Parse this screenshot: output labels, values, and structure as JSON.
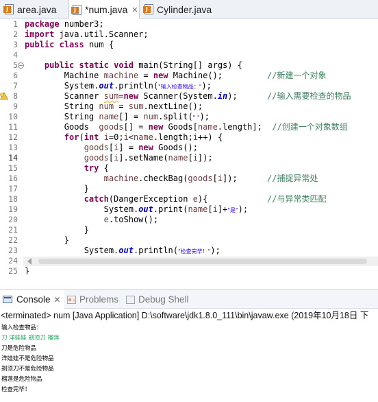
{
  "editor_tabs": [
    {
      "label": "area.java",
      "active": false
    },
    {
      "label": "*num.java",
      "active": true
    },
    {
      "label": "Cylinder.java",
      "active": false
    }
  ],
  "code_lines": [
    {
      "n": "1",
      "tokens": [
        {
          "t": "package",
          "c": "kw"
        },
        {
          "t": " number3;"
        }
      ]
    },
    {
      "n": "2",
      "tokens": [
        {
          "t": "import",
          "c": "kw"
        },
        {
          "t": " java.util.Scanner;"
        }
      ]
    },
    {
      "n": "3",
      "tokens": [
        {
          "t": "public",
          "c": "kw"
        },
        {
          "t": " "
        },
        {
          "t": "class",
          "c": "kw"
        },
        {
          "t": " num {"
        }
      ]
    },
    {
      "n": "4",
      "tokens": []
    },
    {
      "n": "5",
      "fold": true,
      "tokens": [
        {
          "t": "    "
        },
        {
          "t": "public",
          "c": "kw"
        },
        {
          "t": " "
        },
        {
          "t": "static",
          "c": "kw"
        },
        {
          "t": " "
        },
        {
          "t": "void",
          "c": "kw"
        },
        {
          "t": " main(String[] args) {"
        }
      ]
    },
    {
      "n": "6",
      "tokens": [
        {
          "t": "        Machine "
        },
        {
          "t": "machine",
          "c": "var"
        },
        {
          "t": " = "
        },
        {
          "t": "new",
          "c": "kw"
        },
        {
          "t": " Machine();         "
        },
        {
          "t": "//新建一个对象",
          "c": "cmt"
        }
      ]
    },
    {
      "n": "7",
      "tokens": [
        {
          "t": "        System."
        },
        {
          "t": "out",
          "c": "fld"
        },
        {
          "t": ".println("
        },
        {
          "t": "\"输入检查物品：\"",
          "c": "str"
        },
        {
          "t": ");"
        }
      ]
    },
    {
      "n": "8",
      "warn": true,
      "tokens": [
        {
          "t": "        Scanner "
        },
        {
          "t": "sum",
          "c": "var warnline"
        },
        {
          "t": "="
        },
        {
          "t": "new",
          "c": "kw"
        },
        {
          "t": " Scanner(System."
        },
        {
          "t": "in",
          "c": "fld"
        },
        {
          "t": ");      "
        },
        {
          "t": "//输入需要检查的物品",
          "c": "cmt"
        }
      ]
    },
    {
      "n": "9",
      "tokens": [
        {
          "t": "        String "
        },
        {
          "t": "num",
          "c": "var"
        },
        {
          "t": " = "
        },
        {
          "t": "sum",
          "c": "var"
        },
        {
          "t": ".nextLine();"
        }
      ]
    },
    {
      "n": "10",
      "tokens": [
        {
          "t": "        String "
        },
        {
          "t": "name",
          "c": "var"
        },
        {
          "t": "[] = "
        },
        {
          "t": "num",
          "c": "var"
        },
        {
          "t": ".split("
        },
        {
          "t": "\" \"",
          "c": "str"
        },
        {
          "t": ");"
        }
      ]
    },
    {
      "n": "11",
      "tokens": [
        {
          "t": "        Goods  "
        },
        {
          "t": "goods",
          "c": "var"
        },
        {
          "t": "[] = "
        },
        {
          "t": "new",
          "c": "kw"
        },
        {
          "t": " Goods["
        },
        {
          "t": "name",
          "c": "var"
        },
        {
          "t": ".length];  "
        },
        {
          "t": "//创建一个对象数组",
          "c": "cmt"
        }
      ]
    },
    {
      "n": "12",
      "tokens": [
        {
          "t": "        "
        },
        {
          "t": "for",
          "c": "kw"
        },
        {
          "t": "("
        },
        {
          "t": "int",
          "c": "kw"
        },
        {
          "t": " "
        },
        {
          "t": "i",
          "c": "var"
        },
        {
          "t": "=0;"
        },
        {
          "t": "i",
          "c": "var"
        },
        {
          "t": "<"
        },
        {
          "t": "name",
          "c": "var"
        },
        {
          "t": ".length;"
        },
        {
          "t": "i",
          "c": "var"
        },
        {
          "t": "++) {"
        }
      ]
    },
    {
      "n": "13",
      "tokens": [
        {
          "t": "            "
        },
        {
          "t": "goods",
          "c": "var"
        },
        {
          "t": "["
        },
        {
          "t": "i",
          "c": "var"
        },
        {
          "t": "] = "
        },
        {
          "t": "new",
          "c": "kw"
        },
        {
          "t": " Goods();"
        }
      ]
    },
    {
      "n": "14",
      "current": true,
      "tokens": [
        {
          "t": "            "
        },
        {
          "t": "goods",
          "c": "var"
        },
        {
          "t": "["
        },
        {
          "t": "i",
          "c": "var"
        },
        {
          "t": "].setName("
        },
        {
          "t": "name",
          "c": "var"
        },
        {
          "t": "["
        },
        {
          "t": "i",
          "c": "var"
        },
        {
          "t": "]);"
        }
      ]
    },
    {
      "n": "15",
      "tokens": [
        {
          "t": "            "
        },
        {
          "t": "try",
          "c": "kw"
        },
        {
          "t": " {"
        }
      ]
    },
    {
      "n": "16",
      "tokens": [
        {
          "t": "                "
        },
        {
          "t": "machine",
          "c": "var"
        },
        {
          "t": ".checkBag("
        },
        {
          "t": "goods",
          "c": "var"
        },
        {
          "t": "["
        },
        {
          "t": "i",
          "c": "var"
        },
        {
          "t": "]);      "
        },
        {
          "t": "//捕捉异常处",
          "c": "cmt"
        }
      ]
    },
    {
      "n": "17",
      "tokens": [
        {
          "t": "            }"
        }
      ]
    },
    {
      "n": "18",
      "tokens": [
        {
          "t": "            "
        },
        {
          "t": "catch",
          "c": "kw"
        },
        {
          "t": "(DangerException "
        },
        {
          "t": "e",
          "c": "var"
        },
        {
          "t": "){            "
        },
        {
          "t": "//与异常类匹配",
          "c": "cmt"
        }
      ]
    },
    {
      "n": "19",
      "tokens": [
        {
          "t": "                System."
        },
        {
          "t": "out",
          "c": "fld"
        },
        {
          "t": ".print("
        },
        {
          "t": "name",
          "c": "var"
        },
        {
          "t": "["
        },
        {
          "t": "i",
          "c": "var"
        },
        {
          "t": "]+"
        },
        {
          "t": "\"是\"",
          "c": "str"
        },
        {
          "t": ");"
        }
      ]
    },
    {
      "n": "20",
      "tokens": [
        {
          "t": "                "
        },
        {
          "t": "e",
          "c": "var"
        },
        {
          "t": ".toShow();"
        }
      ]
    },
    {
      "n": "21",
      "tokens": [
        {
          "t": "            }"
        }
      ]
    },
    {
      "n": "22",
      "tokens": [
        {
          "t": "        }"
        }
      ]
    },
    {
      "n": "23",
      "tokens": [
        {
          "t": "            System."
        },
        {
          "t": "out",
          "c": "fld"
        },
        {
          "t": ".println("
        },
        {
          "t": "\"检查完毕！\"",
          "c": "str"
        },
        {
          "t": ");"
        }
      ]
    },
    {
      "n": "24",
      "tokens": [
        {
          "t": "    }"
        }
      ]
    },
    {
      "n": "25",
      "tokens": [
        {
          "t": "}"
        }
      ]
    }
  ],
  "console_tabs": [
    {
      "label": "Console",
      "active": true
    },
    {
      "label": "Problems",
      "active": false
    },
    {
      "label": "Debug Shell",
      "active": false
    }
  ],
  "console_header": "<terminated> num [Java Application] D:\\software\\jdk1.8.0_111\\bin\\javaw.exe (2019年10月18日 下",
  "console_output": [
    {
      "text": "输入检查物品：",
      "input": false
    },
    {
      "text": "刀 洋娃娃 剃须刀 榴莲",
      "input": true
    },
    {
      "text": "刀是危险物品",
      "input": false
    },
    {
      "text": "洋娃娃不是危险物品",
      "input": false
    },
    {
      "text": "剃须刀不是危险物品",
      "input": false
    },
    {
      "text": "榴莲是危险物品",
      "input": false
    },
    {
      "text": "检查完毕！",
      "input": false
    }
  ],
  "colors": {
    "keyword": "#7f0055",
    "comment": "#3f7f5f",
    "string": "#2a00ff",
    "field": "#0000c0",
    "variable": "#6a3e3e",
    "console_input": "#1aa05a"
  }
}
